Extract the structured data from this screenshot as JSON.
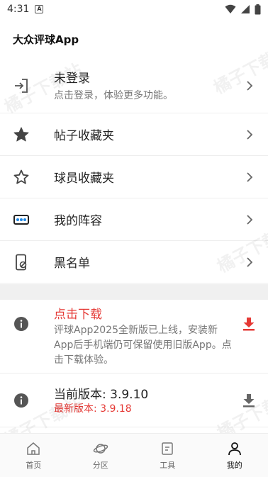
{
  "status_bar": {
    "time": "4:31",
    "a_icon": "A"
  },
  "app_title": "大众评球App",
  "menu": [
    {
      "icon": "login-icon",
      "title": "未登录",
      "subtitle": "点击登录，体验更多功能。"
    },
    {
      "icon": "star-filled-icon",
      "title": "帖子收藏夹"
    },
    {
      "icon": "star-outline-icon",
      "title": "球员收藏夹"
    },
    {
      "icon": "lineup-icon",
      "title": "我的阵容"
    },
    {
      "icon": "blocked-phone-icon",
      "title": "黑名单"
    }
  ],
  "download": {
    "title": "点击下载",
    "description": "评球App2025全新版已上线，安装新App后手机端仍可保留使用旧版App。点击下载体验。"
  },
  "version": {
    "current": "当前版本: 3.9.10",
    "latest": "最新版本: 3.9.18"
  },
  "bottom_nav": [
    {
      "icon": "home-icon",
      "label": "首页"
    },
    {
      "icon": "planet-icon",
      "label": "分区"
    },
    {
      "icon": "tools-icon",
      "label": "工具"
    },
    {
      "icon": "person-icon",
      "label": "我的",
      "active": true
    }
  ],
  "watermark": "橘子下载站",
  "colors": {
    "accent_red": "#e53935",
    "icon_gray": "#555555"
  }
}
